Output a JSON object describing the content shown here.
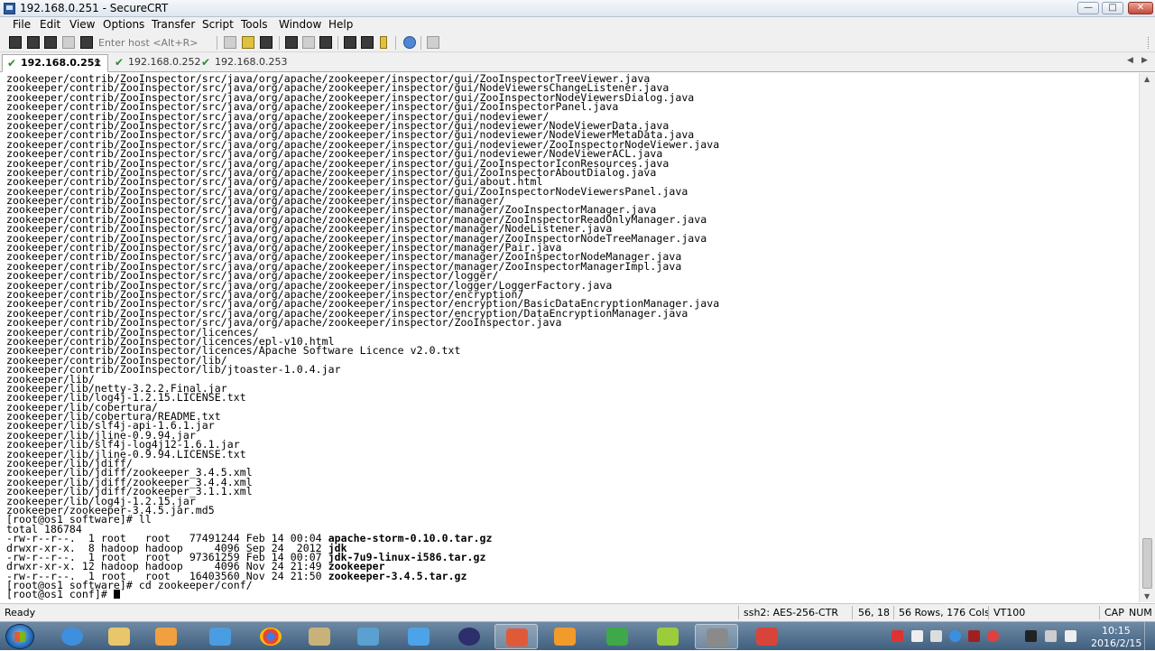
{
  "window": {
    "title": "192.168.0.251 - SecureCRT",
    "controls": {
      "minimize": "—",
      "maximize": "□",
      "close": "✕"
    }
  },
  "menu": [
    "File",
    "Edit",
    "View",
    "Options",
    "Transfer",
    "Script",
    "Tools",
    "Window",
    "Help"
  ],
  "toolbar": {
    "quick_connect_placeholder": "Enter host <Alt+R>"
  },
  "tabs": [
    {
      "label": "192.168.0.251",
      "active": true,
      "close": "×",
      "check": "✔"
    },
    {
      "label": "192.168.0.252",
      "active": false,
      "check": "✔"
    },
    {
      "label": "192.168.0.253",
      "active": false,
      "check": "✔"
    }
  ],
  "tab_scroll": {
    "left": "◀",
    "right": "▶"
  },
  "terminal": {
    "lines": [
      "zookeeper/contrib/ZooInspector/src/java/org/apache/zookeeper/inspector/gui/ZooInspectorTreeViewer.java",
      "zookeeper/contrib/ZooInspector/src/java/org/apache/zookeeper/inspector/gui/NodeViewersChangeListener.java",
      "zookeeper/contrib/ZooInspector/src/java/org/apache/zookeeper/inspector/gui/ZooInspectorNodeViewersDialog.java",
      "zookeeper/contrib/ZooInspector/src/java/org/apache/zookeeper/inspector/gui/ZooInspectorPanel.java",
      "zookeeper/contrib/ZooInspector/src/java/org/apache/zookeeper/inspector/gui/nodeviewer/",
      "zookeeper/contrib/ZooInspector/src/java/org/apache/zookeeper/inspector/gui/nodeviewer/NodeViewerData.java",
      "zookeeper/contrib/ZooInspector/src/java/org/apache/zookeeper/inspector/gui/nodeviewer/NodeViewerMetaData.java",
      "zookeeper/contrib/ZooInspector/src/java/org/apache/zookeeper/inspector/gui/nodeviewer/ZooInspectorNodeViewer.java",
      "zookeeper/contrib/ZooInspector/src/java/org/apache/zookeeper/inspector/gui/nodeviewer/NodeViewerACL.java",
      "zookeeper/contrib/ZooInspector/src/java/org/apache/zookeeper/inspector/gui/ZooInspectorIconResources.java",
      "zookeeper/contrib/ZooInspector/src/java/org/apache/zookeeper/inspector/gui/ZooInspectorAboutDialog.java",
      "zookeeper/contrib/ZooInspector/src/java/org/apache/zookeeper/inspector/gui/about.html",
      "zookeeper/contrib/ZooInspector/src/java/org/apache/zookeeper/inspector/gui/ZooInspectorNodeViewersPanel.java",
      "zookeeper/contrib/ZooInspector/src/java/org/apache/zookeeper/inspector/manager/",
      "zookeeper/contrib/ZooInspector/src/java/org/apache/zookeeper/inspector/manager/ZooInspectorManager.java",
      "zookeeper/contrib/ZooInspector/src/java/org/apache/zookeeper/inspector/manager/ZooInspectorReadOnlyManager.java",
      "zookeeper/contrib/ZooInspector/src/java/org/apache/zookeeper/inspector/manager/NodeListener.java",
      "zookeeper/contrib/ZooInspector/src/java/org/apache/zookeeper/inspector/manager/ZooInspectorNodeTreeManager.java",
      "zookeeper/contrib/ZooInspector/src/java/org/apache/zookeeper/inspector/manager/Pair.java",
      "zookeeper/contrib/ZooInspector/src/java/org/apache/zookeeper/inspector/manager/ZooInspectorNodeManager.java",
      "zookeeper/contrib/ZooInspector/src/java/org/apache/zookeeper/inspector/manager/ZooInspectorManagerImpl.java",
      "zookeeper/contrib/ZooInspector/src/java/org/apache/zookeeper/inspector/logger/",
      "zookeeper/contrib/ZooInspector/src/java/org/apache/zookeeper/inspector/logger/LoggerFactory.java",
      "zookeeper/contrib/ZooInspector/src/java/org/apache/zookeeper/inspector/encryption/",
      "zookeeper/contrib/ZooInspector/src/java/org/apache/zookeeper/inspector/encryption/BasicDataEncryptionManager.java",
      "zookeeper/contrib/ZooInspector/src/java/org/apache/zookeeper/inspector/encryption/DataEncryptionManager.java",
      "zookeeper/contrib/ZooInspector/src/java/org/apache/zookeeper/inspector/ZooInspector.java",
      "zookeeper/contrib/ZooInspector/licences/",
      "zookeeper/contrib/ZooInspector/licences/epl-v10.html",
      "zookeeper/contrib/ZooInspector/licences/Apache Software Licence v2.0.txt",
      "zookeeper/contrib/ZooInspector/lib/",
      "zookeeper/contrib/ZooInspector/lib/jtoaster-1.0.4.jar",
      "zookeeper/lib/",
      "zookeeper/lib/netty-3.2.2.Final.jar",
      "zookeeper/lib/log4j-1.2.15.LICENSE.txt",
      "zookeeper/lib/cobertura/",
      "zookeeper/lib/cobertura/README.txt",
      "zookeeper/lib/slf4j-api-1.6.1.jar",
      "zookeeper/lib/jline-0.9.94.jar",
      "zookeeper/lib/slf4j-log4j12-1.6.1.jar",
      "zookeeper/lib/jline-0.9.94.LICENSE.txt",
      "zookeeper/lib/jdiff/",
      "zookeeper/lib/jdiff/zookeeper_3.4.5.xml",
      "zookeeper/lib/jdiff/zookeeper_3.4.4.xml",
      "zookeeper/lib/jdiff/zookeeper_3.1.1.xml",
      "zookeeper/lib/log4j-1.2.15.jar",
      "zookeeper/zookeeper-3.4.5.jar.md5",
      "[root@os1 software]# ll",
      "total 186784"
    ],
    "listing": [
      {
        "prefix": "-rw-r--r--.  1 root   root   77491244 Feb 14 00:04 ",
        "name": "apache-storm-0.10.0.tar.gz"
      },
      {
        "prefix": "drwxr-xr-x.  8 hadoop hadoop     4096 Sep 24  2012 ",
        "name": "jdk"
      },
      {
        "prefix": "-rw-r--r--.  1 root   root   97361259 Feb 14 00:07 ",
        "name": "jdk-7u9-linux-i586.tar.gz"
      },
      {
        "prefix": "drwxr-xr-x. 12 hadoop hadoop     4096 Nov 24 21:49 ",
        "name": "zookeeper"
      },
      {
        "prefix": "-rw-r--r--.  1 root   root   16403560 Nov 24 21:50 ",
        "name": "zookeeper-3.4.5.tar.gz"
      }
    ],
    "after": [
      "[root@os1 software]# cd zookeeper/conf/"
    ],
    "prompt": "[root@os1 conf]# "
  },
  "scrollbar": {
    "up": "▲",
    "down": "▼"
  },
  "status": {
    "ready": "Ready",
    "encryption": "ssh2: AES-256-CTR",
    "position": "56, 18",
    "size": "56 Rows, 176 Cols",
    "emulation": "VT100",
    "caps": "CAP",
    "num": "NUM"
  },
  "clock": {
    "time": "10:15",
    "date": "2016/2/15"
  }
}
